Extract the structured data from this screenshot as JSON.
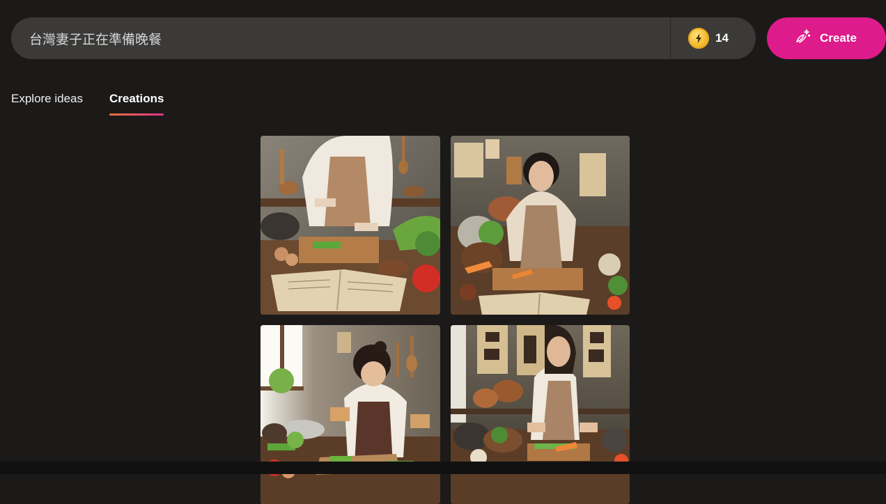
{
  "prompt": {
    "value": "台灣妻子正在準備晚餐",
    "placeholder": ""
  },
  "boosts": {
    "count": "14",
    "icon": "lightning-coin-icon"
  },
  "create_button": {
    "label": "Create",
    "icon": "magic-wand-icon",
    "color": "#de1b8a"
  },
  "tabs": [
    {
      "label": "Explore ideas",
      "active": false
    },
    {
      "label": "Creations",
      "active": true
    }
  ],
  "images": [
    {
      "alt": "Woman in apron slicing vegetables on wooden board with open recipe book"
    },
    {
      "alt": "Smiling woman chopping carrots in rustic kitchen with hanging notes"
    },
    {
      "alt": "Woman cutting greens near window with plants and cookware"
    },
    {
      "alt": "Woman slicing vegetables beneath calligraphy scrolls"
    }
  ]
}
